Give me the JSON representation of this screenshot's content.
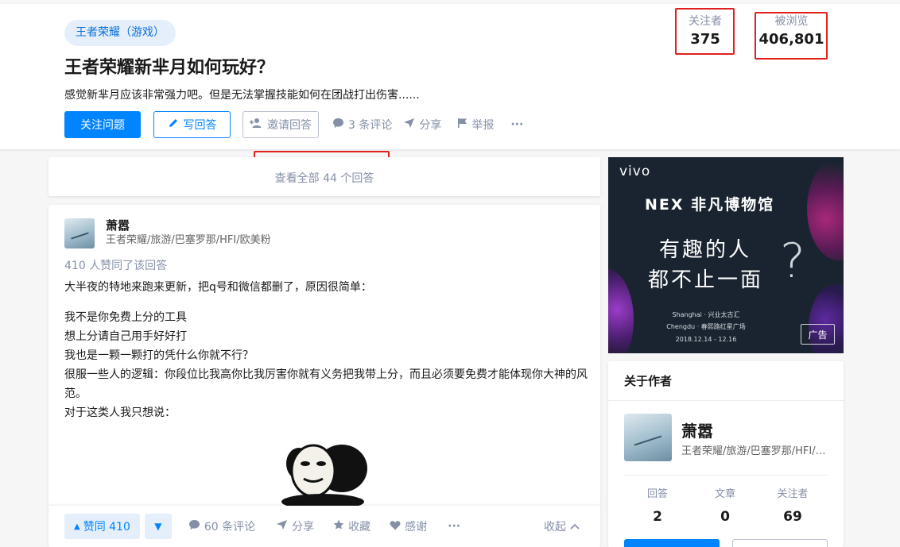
{
  "question": {
    "topic": "王者荣耀（游戏）",
    "title": "王者荣耀新芈月如何玩好？",
    "detail": "感觉新芈月应该非常强力吧。但是无法掌握技能如何在团战打出伤害......",
    "actions": {
      "follow": "关注问题",
      "write": "写回答",
      "invite": "邀请回答",
      "comments": "3 条评论",
      "share": "分享",
      "report": "举报",
      "more": "···"
    },
    "stats": {
      "followers_label": "关注者",
      "followers_value": "375",
      "views_label": "被浏览",
      "views_value": "406,801"
    }
  },
  "view_all": "查看全部 44 个回答",
  "answer": {
    "author_name": "萧嚣",
    "author_bio": "王者荣耀/旅游/巴塞罗那/HFI/欧美粉",
    "vote_info": "410 人赞同了该回答",
    "lines": {
      "l1": "大半夜的特地来跑来更新，把q号和微信都删了，原因很简单：",
      "l2": "我不是你免费上分的工具",
      "l3": "想上分请自己用手好好打",
      "l4": "我也是一颗一颗打的凭什么你就不行？",
      "l5": "很服一些人的逻辑：你段位比我高你比我厉害你就有义务把我带上分，而且必须要免费才能体现你大神的风范。",
      "l6": "对于这类人我只想说："
    },
    "actions": {
      "upvote": "赞同 410",
      "comments": "60 条评论",
      "share": "分享",
      "collect": "收藏",
      "thanks": "感谢",
      "more": "···",
      "collapse": "收起"
    }
  },
  "ad": {
    "brand": "vivo",
    "product": "NEX 非凡博物馆",
    "slogan_line1": "有趣的人",
    "slogan_line2": "都不止一面",
    "qmark": "?",
    "venue1": "Shanghai · 兴业太古汇",
    "venue2": "Chengdu · 春熙路红星广场",
    "dates": "2018.12.14 - 12.16",
    "label": "广告"
  },
  "about_author": {
    "heading": "关于作者",
    "name": "萧嚣",
    "bio": "王者荣耀/旅游/巴塞罗那/HFI/欧美粉",
    "answers_label": "回答",
    "answers_value": "2",
    "articles_label": "文章",
    "articles_value": "0",
    "followers_label": "关注者",
    "followers_value": "69"
  },
  "colors": {
    "accent": "#0084ff",
    "highlight_box": "#e0201e",
    "muted": "#8590a6"
  }
}
